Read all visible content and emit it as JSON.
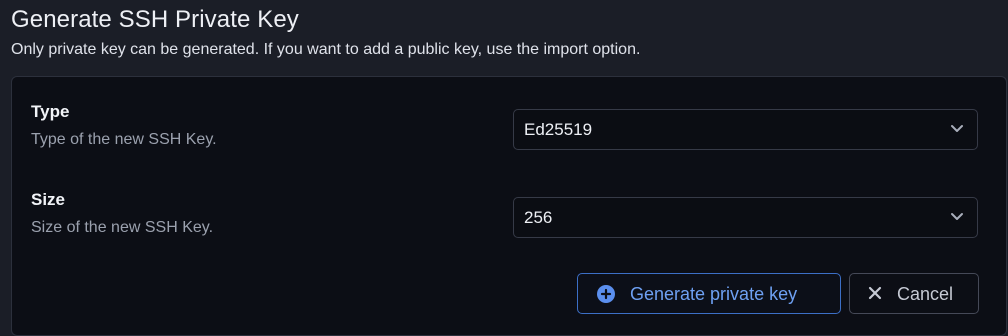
{
  "header": {
    "title": "Generate SSH Private Key",
    "subtitle": "Only private key can be generated. If you want to add a public key, use the import option."
  },
  "form": {
    "type": {
      "label": "Type",
      "help": "Type of the new SSH Key.",
      "value": "Ed25519"
    },
    "size": {
      "label": "Size",
      "help": "Size of the new SSH Key.",
      "value": "256"
    }
  },
  "actions": {
    "generate_label": "Generate private key",
    "generate_icon": "plus-circle-icon",
    "cancel_label": "Cancel",
    "cancel_icon": "close-icon"
  },
  "colors": {
    "background": "#1b1e27",
    "panel": "#0c0e15",
    "accent": "#6ea0f2"
  }
}
